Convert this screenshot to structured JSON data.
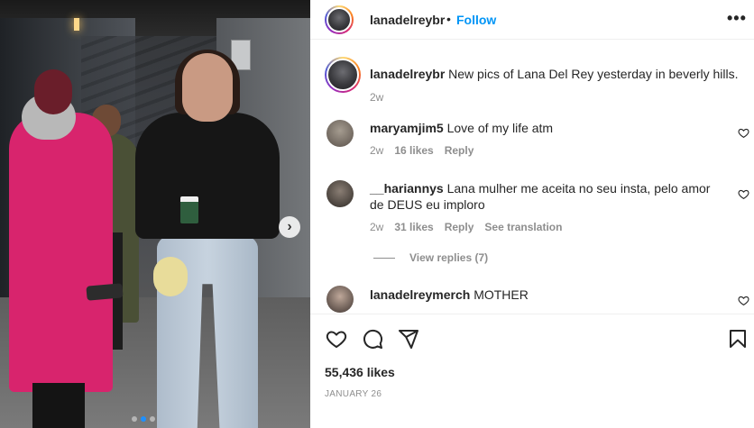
{
  "post": {
    "username": "lanadelreybr",
    "separator": "•",
    "follow_label": "Follow",
    "more_label": "•••"
  },
  "carousel": {
    "next_label": "›",
    "slide_count": 3,
    "active_index": 1
  },
  "caption": {
    "username": "lanadelreybr",
    "text": "New pics of Lana Del Rey yesterday in beverly hills.",
    "time": "2w"
  },
  "comments": [
    {
      "username": "maryamjim5",
      "text": "Love of my life atm",
      "time": "2w",
      "likes": "16 likes",
      "reply": "Reply"
    },
    {
      "username": "__hariannys",
      "text": "Lana mulher me aceita no seu insta, pelo amor de DEUS eu imploro",
      "time": "2w",
      "likes": "31 likes",
      "reply": "Reply",
      "translation": "See translation"
    },
    {
      "username": "lanadelreymerch",
      "text": "MOTHER"
    }
  ],
  "view_replies": "View replies (7)",
  "actions": {
    "likes": "55,436 likes",
    "date": "JANUARY 26"
  },
  "colors": {
    "accent": "#0095f6",
    "muted": "#8e8e8e",
    "text": "#262626"
  }
}
